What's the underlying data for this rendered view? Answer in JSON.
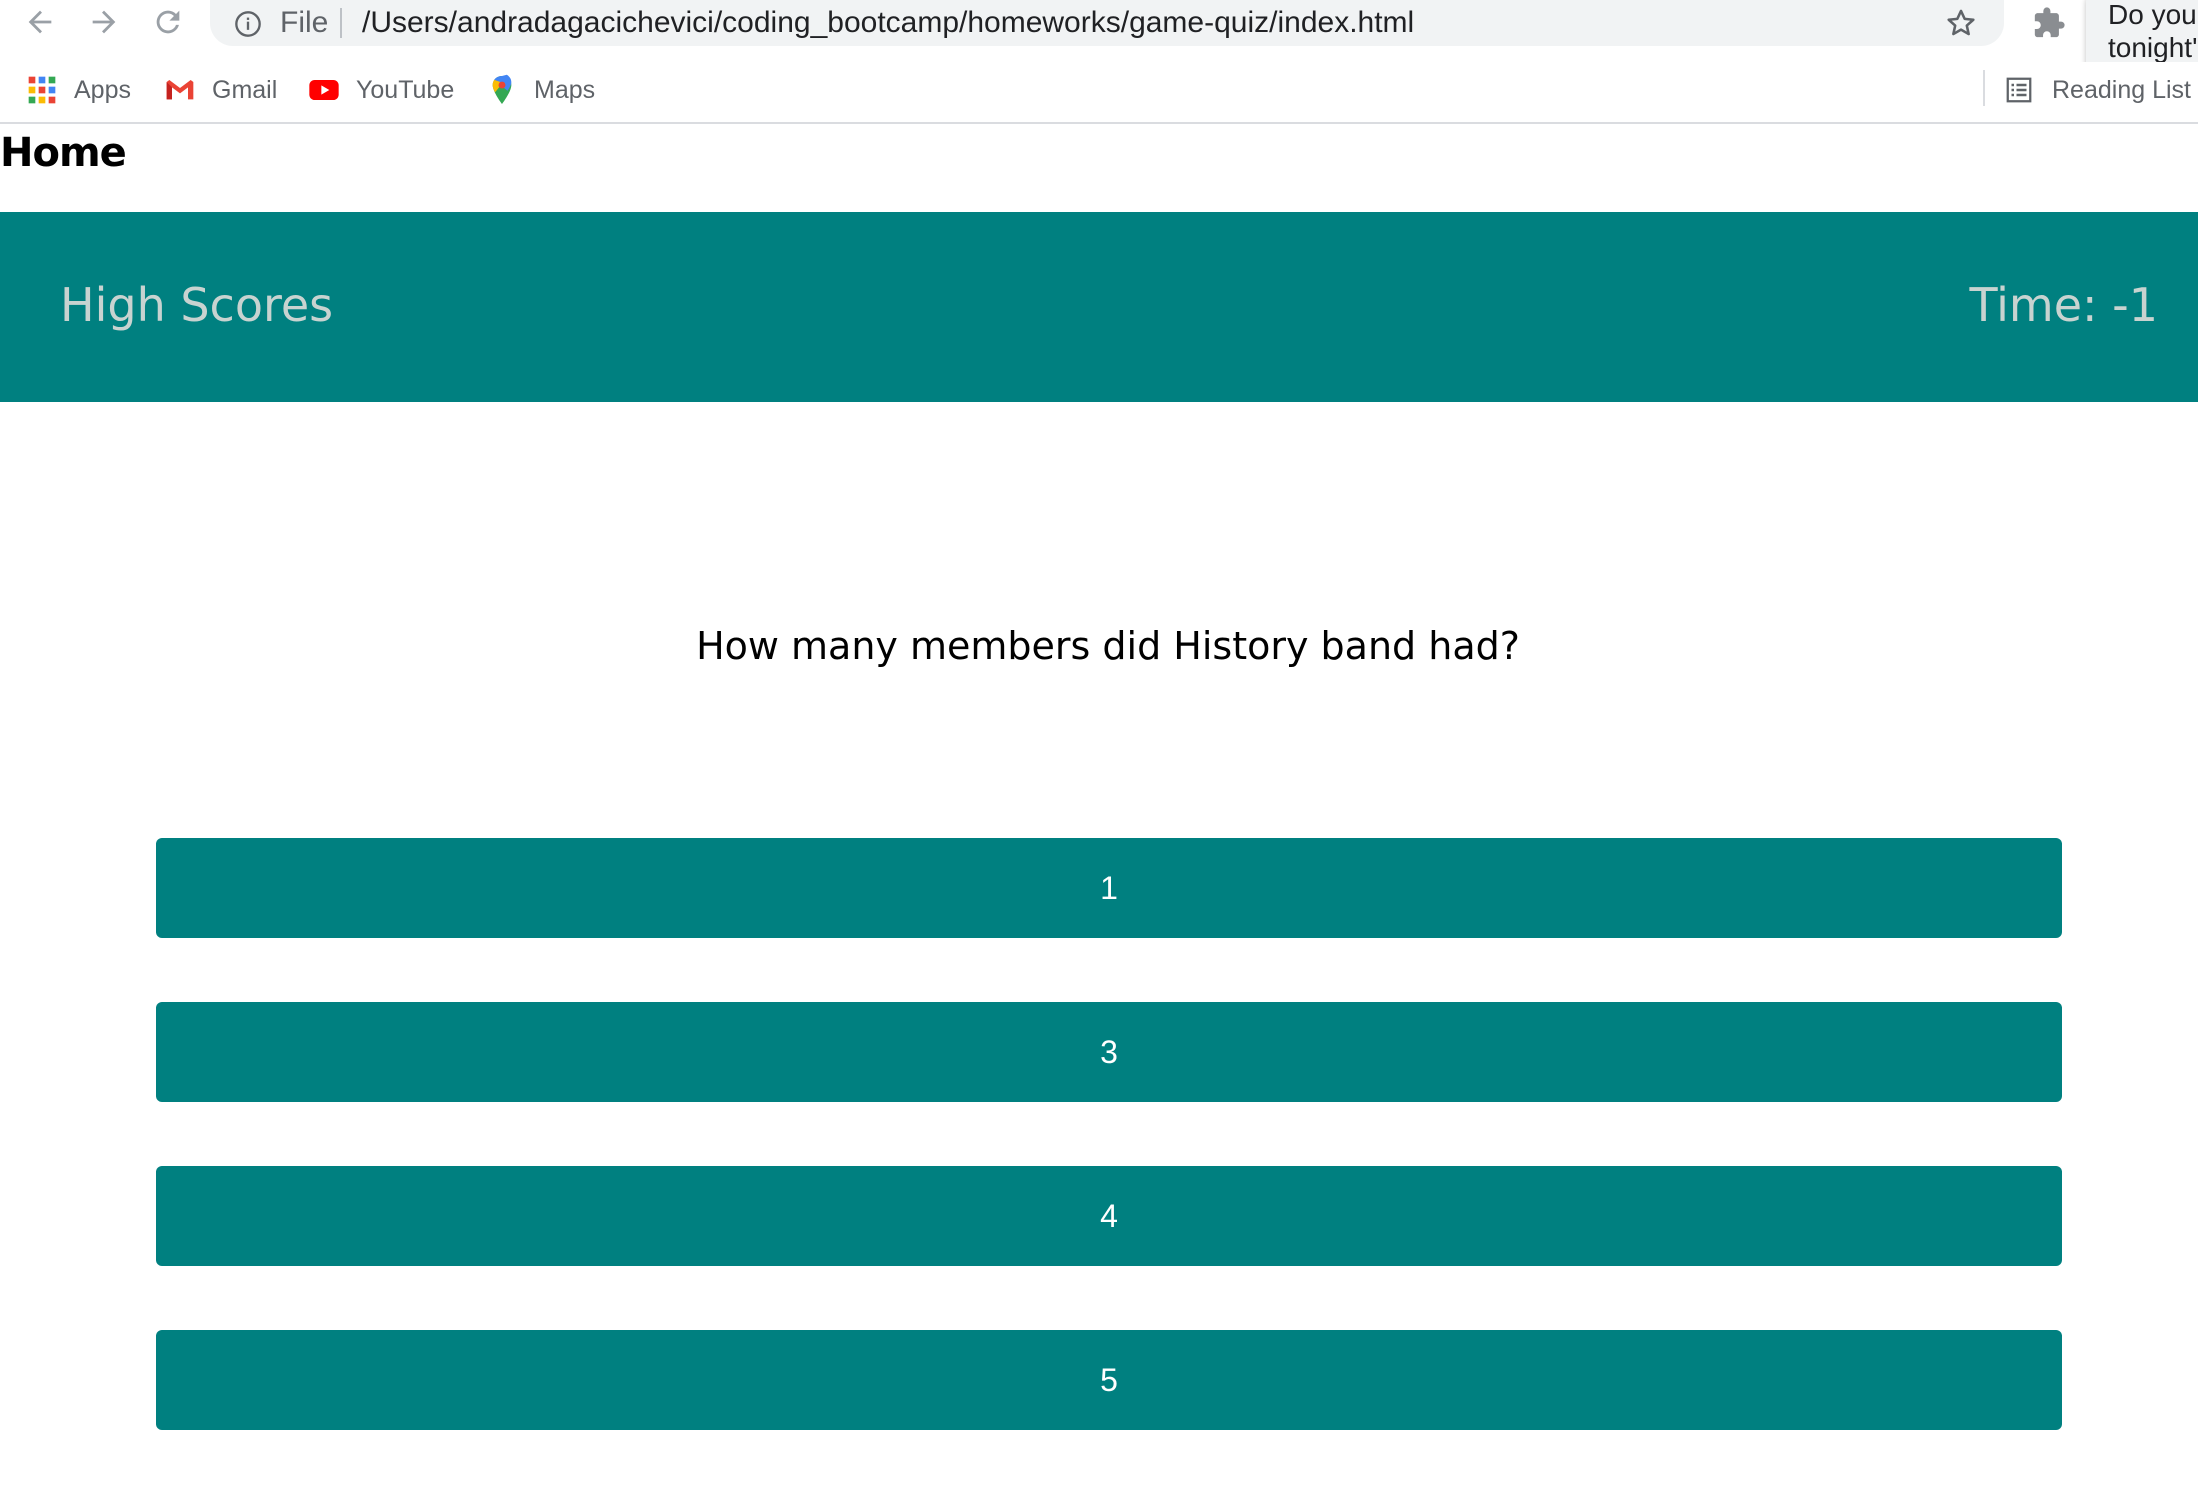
{
  "browser": {
    "scheme_label": "File",
    "url": "/Users/andradagacichevici/coding_bootcamp/homeworks/game-quiz/index.html",
    "popup_line1": "Do you",
    "popup_line2": "tonight'",
    "bookmarks": [
      {
        "label": "Apps",
        "icon": "apps-grid-icon"
      },
      {
        "label": "Gmail",
        "icon": "gmail-icon"
      },
      {
        "label": "YouTube",
        "icon": "youtube-icon"
      },
      {
        "label": "Maps",
        "icon": "maps-pin-icon"
      }
    ],
    "reading_list": "Reading List"
  },
  "page": {
    "home_link": "Home",
    "header": {
      "high_scores": "High Scores",
      "timer": "Time: -1"
    },
    "question": "How many members did History band had?",
    "answers": [
      "1",
      "3",
      "4",
      "5"
    ]
  },
  "colors": {
    "accent": "#008080",
    "header_text": "#c8d3d0"
  }
}
